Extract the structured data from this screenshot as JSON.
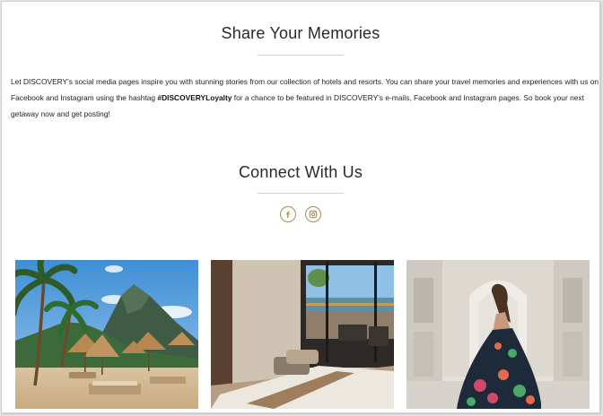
{
  "share": {
    "title": "Share Your Memories",
    "text_part1": "Let DISCOVERY's social media pages inspire you with stunning stories from our collection of hotels and resorts. You can share your travel memories and experiences with us on Facebook and Instagram using the hashtag ",
    "hashtag": "#DISCOVERYLoyalty",
    "text_part2": " for a chance to be featured in DISCOVERY's e-mails, Facebook and Instagram pages. So book your next getaway now and get posting!"
  },
  "connect": {
    "title": "Connect With Us",
    "icons": [
      "facebook-icon",
      "instagram-icon"
    ]
  },
  "gallery": {
    "photos": [
      "beach-resort-photo",
      "hotel-room-sea-view-photo",
      "woman-in-palace-hall-photo"
    ]
  },
  "colors": {
    "accent": "#a58b60",
    "divider": "#e7cfae",
    "background": "#ffffff"
  }
}
